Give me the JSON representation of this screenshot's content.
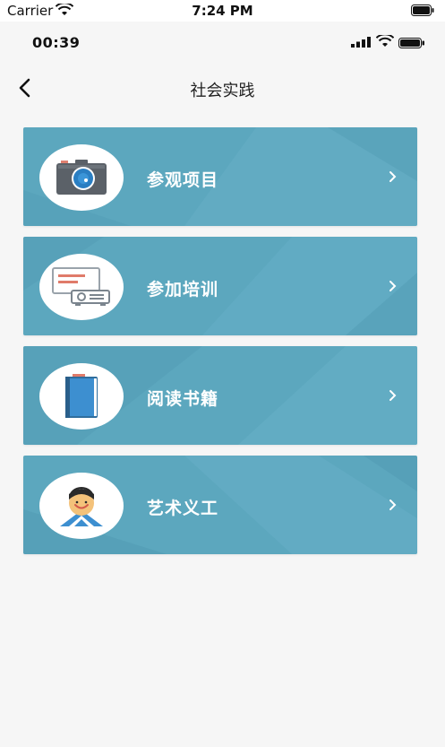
{
  "device_status": {
    "carrier": "Carrier",
    "time": "7:24 PM"
  },
  "app_status": {
    "time": "00:39"
  },
  "nav": {
    "title": "社会实践"
  },
  "menu": {
    "items": [
      {
        "label": "参观项目",
        "icon": "camera-icon"
      },
      {
        "label": "参加培训",
        "icon": "projector-icon"
      },
      {
        "label": "阅读书籍",
        "icon": "book-icon"
      },
      {
        "label": "艺术义工",
        "icon": "volunteer-icon"
      }
    ]
  },
  "colors": {
    "card_bg": "#5ca7be",
    "page_bg": "#f6f6f6",
    "text_on_card": "#ffffff"
  }
}
